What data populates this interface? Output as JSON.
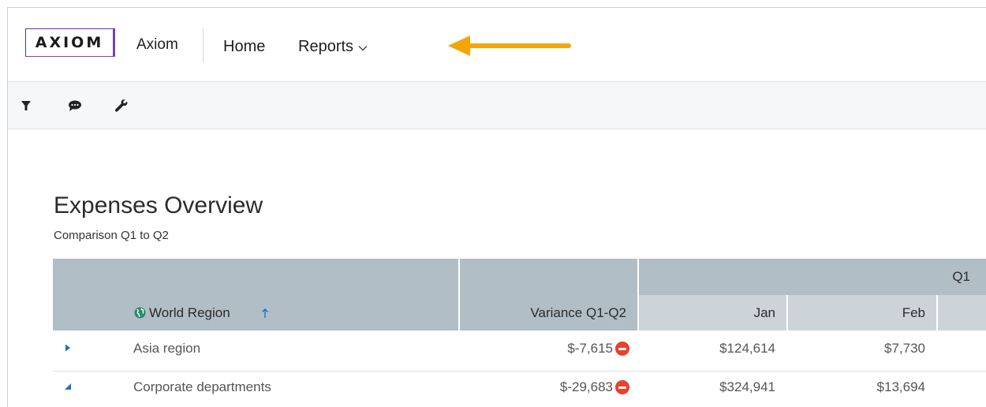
{
  "header": {
    "logo_text": "AXIOM",
    "app_name": "Axiom",
    "nav": {
      "home": "Home",
      "reports": "Reports"
    },
    "arrow_color": "#f5a50a"
  },
  "toolbar": {
    "icons": [
      "filter-icon",
      "comment-icon",
      "wrench-icon"
    ]
  },
  "report": {
    "title": "Expenses Overview",
    "subtitle": "Comparison Q1 to Q2"
  },
  "table": {
    "group_header": "Q1",
    "columns": {
      "region": "World Region",
      "variance": "Variance Q1-Q2",
      "jan": "Jan",
      "feb": "Feb"
    },
    "rows": [
      {
        "region": "Asia region",
        "variance": "$-7,615",
        "jan": "$124,614",
        "feb": "$7,730",
        "expanded": false
      },
      {
        "region": "Corporate departments",
        "variance": "$-29,683",
        "jan": "$324,941",
        "feb": "$13,694",
        "expanded": true
      }
    ]
  },
  "colors": {
    "header_bg": "#b1bec6",
    "subheader_bg": "#ccd4da",
    "accent_blue": "#1f6fc5",
    "negative": "#e8412e",
    "globe": "#2a8a6e"
  }
}
